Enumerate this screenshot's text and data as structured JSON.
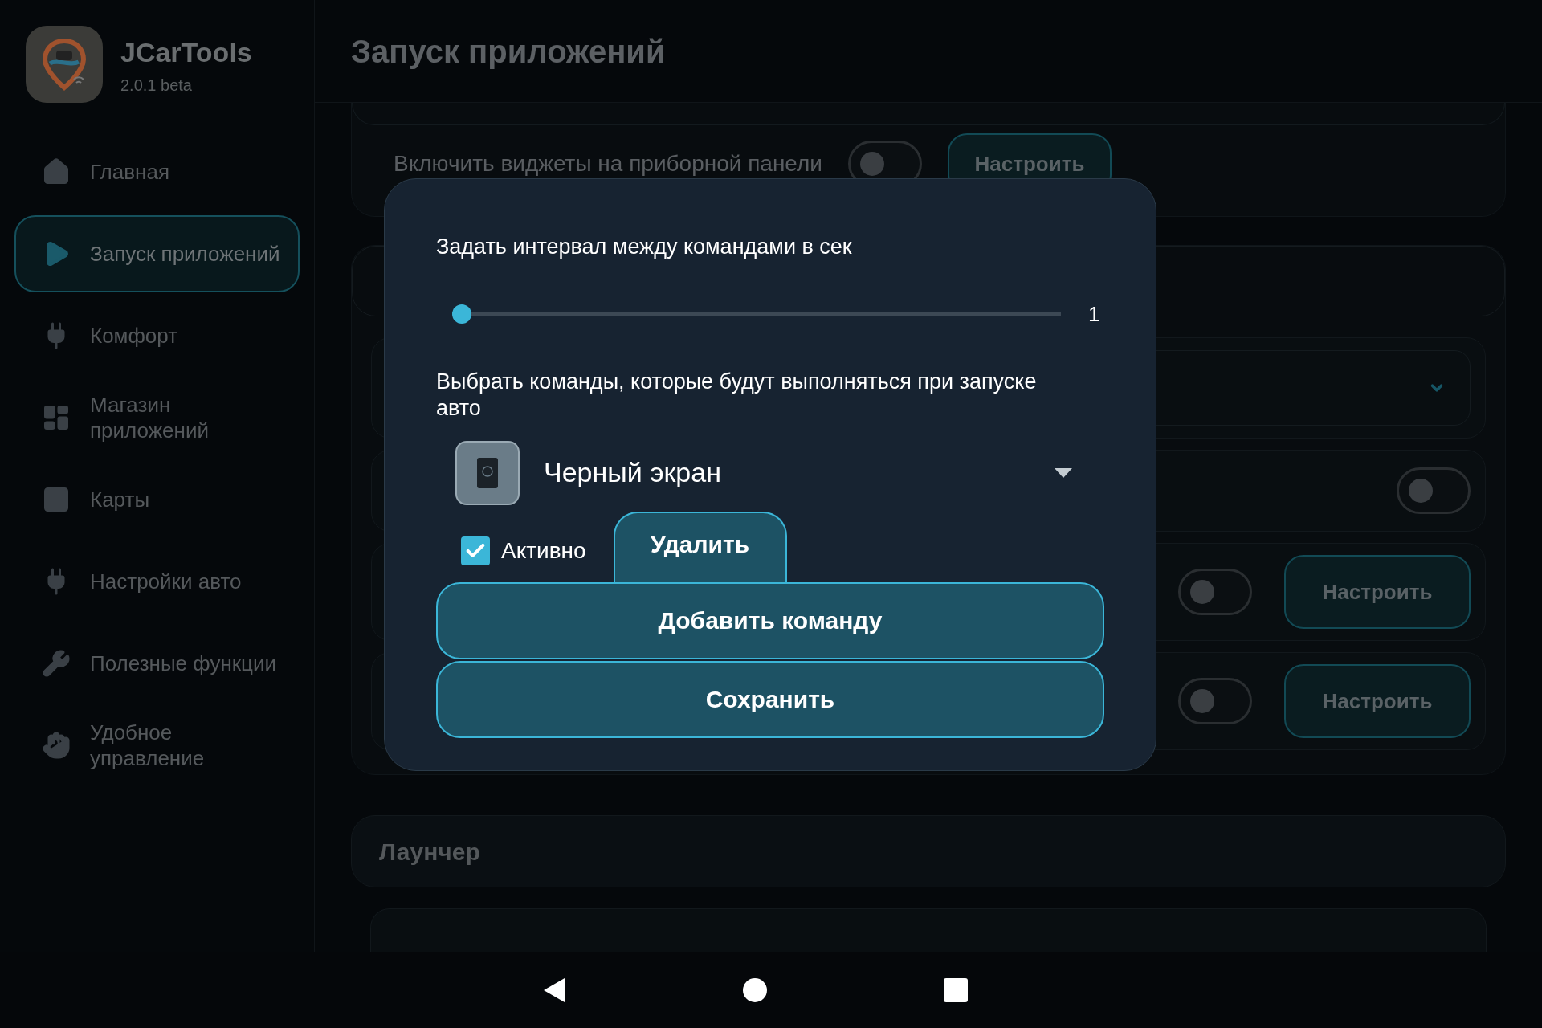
{
  "app": {
    "name": "JCarTools",
    "version": "2.0.1 beta"
  },
  "sidebar": {
    "items": [
      {
        "label": "Главная",
        "selected": false
      },
      {
        "label": "Запуск приложений",
        "selected": true
      },
      {
        "label": "Комфорт",
        "selected": false
      },
      {
        "label": "Магазин приложений",
        "selected": false
      },
      {
        "label": "Карты",
        "selected": false
      },
      {
        "label": "Настройки авто",
        "selected": false
      },
      {
        "label": "Полезные функции",
        "selected": false
      },
      {
        "label": "Удобное управление",
        "selected": false
      }
    ]
  },
  "header": {
    "title": "Запуск приложений"
  },
  "widgets_row": {
    "label": "Включить виджеты на приборной панели",
    "on": false,
    "button": "Настроить"
  },
  "rows": [
    {
      "kind": "dropdown"
    },
    {
      "kind": "toggle",
      "on": false
    },
    {
      "kind": "toggle_button",
      "on": false,
      "button": "Настроить"
    },
    {
      "kind": "toggle_button",
      "on": false,
      "button": "Настроить"
    }
  ],
  "launcher": {
    "title": "Лаунчер"
  },
  "dialog": {
    "interval_label": "Задать интервал между командами в сек",
    "slider": {
      "level": 0,
      "reading": "1"
    },
    "commands_label": "Выбрать команды, которые будут выполняться при запуске авто",
    "command": {
      "name": "Черный экран",
      "active": {
        "label": "Активно",
        "checked": true
      },
      "delete_button": "Удалить"
    },
    "add_button": "Добавить команду",
    "save_button": "Сохранить"
  }
}
